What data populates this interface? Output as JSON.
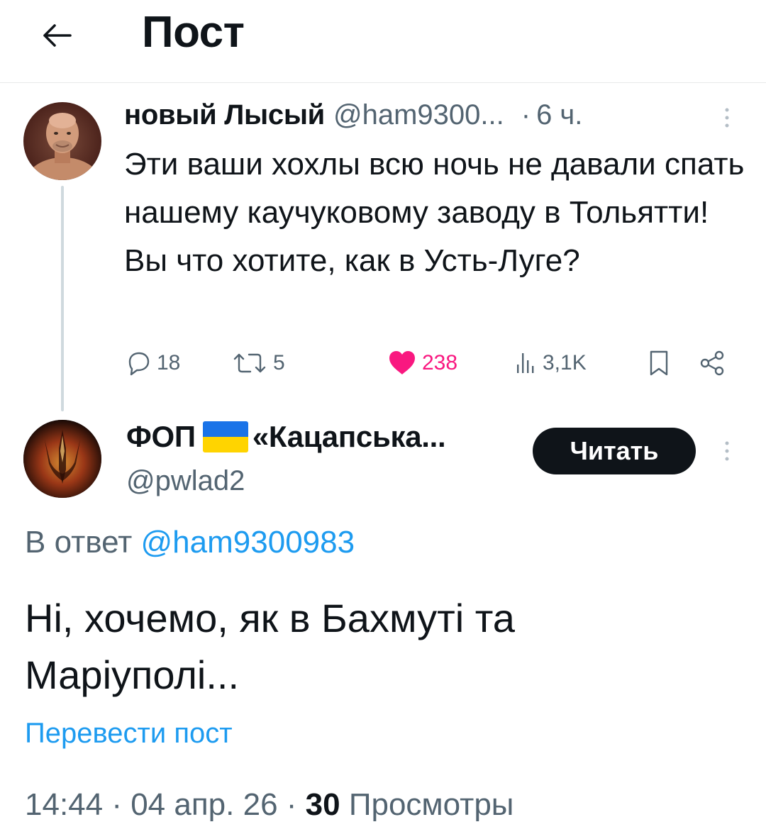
{
  "header": {
    "title": "Пост"
  },
  "tweet1": {
    "name": "новый Лысый",
    "handle": "@ham9300...",
    "dot": "·",
    "time": "6 ч.",
    "text_lines": [
      "Эти ваши хохлы всю ночь не давали спать нашему каучуковому заводу в Тольятти!",
      "Вы что хотите, как в Усть-Луге?"
    ],
    "stats": {
      "replies": "18",
      "reposts": "5",
      "likes": "238",
      "views": "3,1K"
    },
    "colors": {
      "like": "#f91880"
    }
  },
  "tweet2": {
    "name_prefix": "ФОП",
    "name_suffix": "«Кацапська...",
    "handle": "@pwlad2",
    "follow_label": "Читать",
    "reply_prefix": "В ответ",
    "reply_mention": "@ham9300983",
    "text": "Ні, хочемо, як в Бахмуті та Маріуполі...",
    "translate_label": "Перевести пост",
    "meta_date": "14:44 · 04 апр. 26 ·",
    "meta_views_count": "30",
    "meta_views_label": "Просмотры"
  },
  "icons": [
    "back-arrow-icon",
    "more-vertical-icon",
    "reply-icon",
    "repost-icon",
    "heart-icon",
    "views-icon",
    "bookmark-icon",
    "share-icon",
    "ukraine-flag-icon"
  ]
}
